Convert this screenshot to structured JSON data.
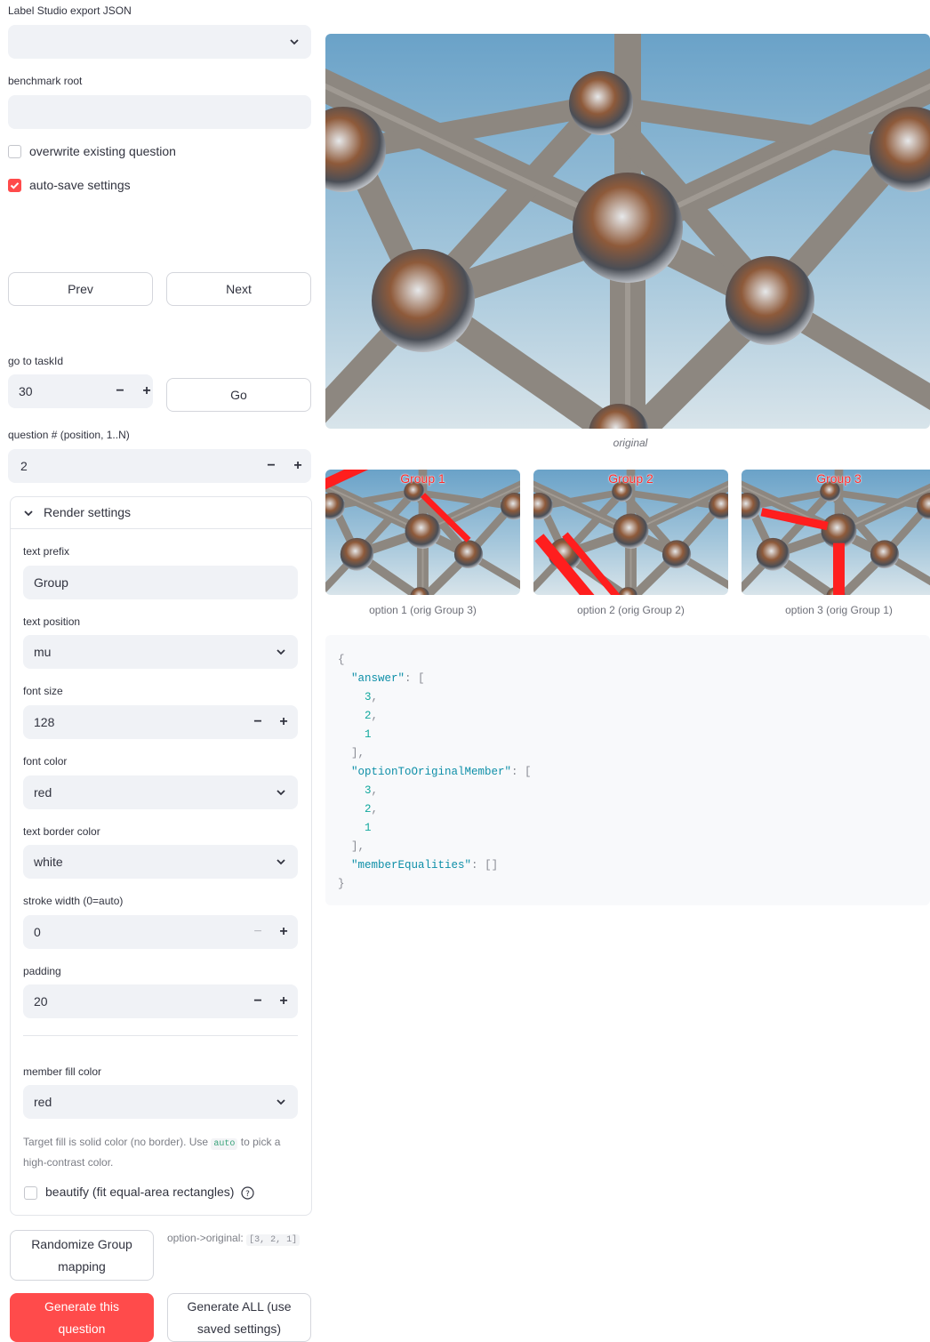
{
  "sidebar": {
    "export_json": {
      "label": "Label Studio export JSON",
      "value": ""
    },
    "benchmark_root": {
      "label": "benchmark root",
      "value": ""
    },
    "overwrite": {
      "label": "overwrite existing question",
      "checked": false
    },
    "autosave": {
      "label": "auto-save settings",
      "checked": true
    },
    "prev_label": "Prev",
    "next_label": "Next",
    "goto": {
      "label": "go to taskId",
      "value": "30",
      "go_label": "Go"
    },
    "question_num": {
      "label": "question # (position, 1..N)",
      "value": "2"
    },
    "render_settings": {
      "title": "Render settings",
      "text_prefix": {
        "label": "text prefix",
        "value": "Group"
      },
      "text_position": {
        "label": "text position",
        "value": "mu"
      },
      "font_size": {
        "label": "font size",
        "value": "128"
      },
      "font_color": {
        "label": "font color",
        "value": "red"
      },
      "text_border_color": {
        "label": "text border color",
        "value": "white"
      },
      "stroke_width": {
        "label": "stroke width (0=auto)",
        "value": "0"
      },
      "padding": {
        "label": "padding",
        "value": "20"
      },
      "member_fill_color": {
        "label": "member fill color",
        "value": "red"
      },
      "help_text_before": "Target fill is solid color (no border). Use ",
      "help_code": "auto",
      "help_text_after": " to pick a high-contrast color.",
      "beautify": {
        "label": "beautify (fit equal-area rectangles)",
        "checked": false
      }
    },
    "randomize_label": "Randomize Group mapping",
    "mapping_label": "option->original:",
    "mapping_value": "[3, 2, 1]",
    "generate_this_label": "Generate this question",
    "generate_all_label": "Generate ALL (use saved settings)"
  },
  "main": {
    "original_caption": "original",
    "options": [
      {
        "overlay": "Group 1",
        "caption": "option 1 (orig Group 3)"
      },
      {
        "overlay": "Group 2",
        "caption": "option 2 (orig Group 2)"
      },
      {
        "overlay": "Group 3",
        "caption": "option 3 (orig Group 1)"
      }
    ],
    "json_output": {
      "answer_key": "\"answer\"",
      "answer": [
        "3",
        "2",
        "1"
      ],
      "mapping_key": "\"optionToOriginalMember\"",
      "mapping": [
        "3",
        "2",
        "1"
      ],
      "equalities_key": "\"memberEqualities\"",
      "equalities_value": "[]"
    }
  },
  "colors": {
    "accent": "#ff4b4b",
    "field_bg": "#f0f2f6",
    "code_key": "#0e8fa8",
    "code_num": "#13a89e"
  }
}
